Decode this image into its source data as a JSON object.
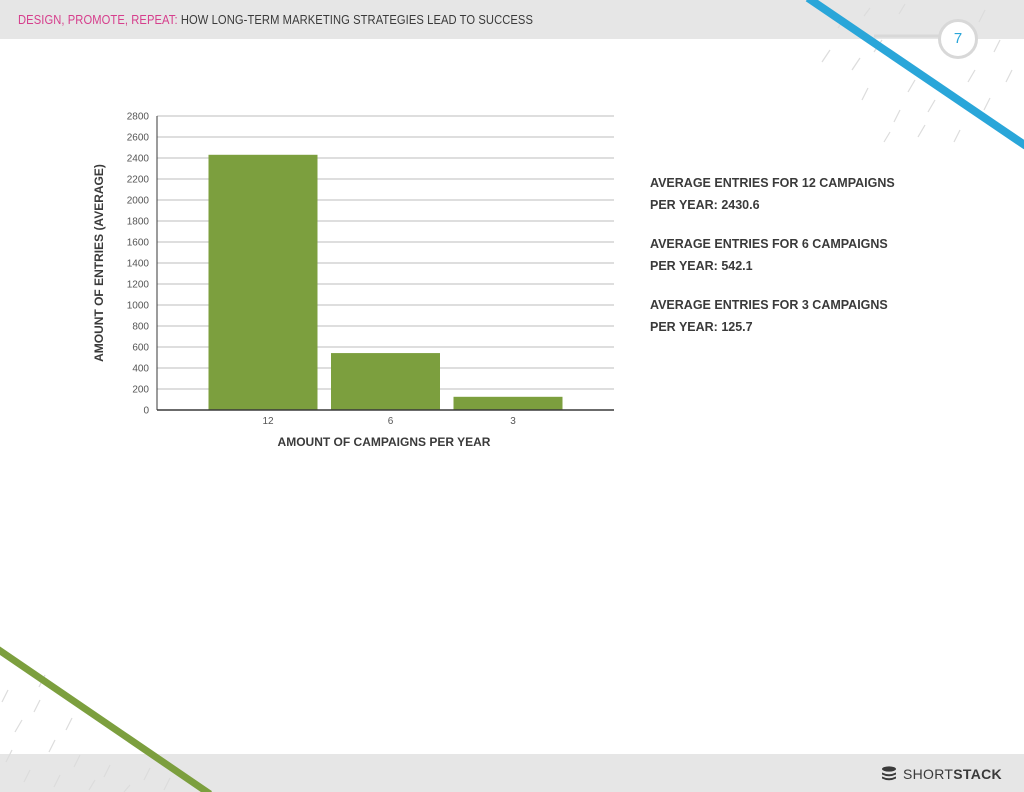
{
  "header": {
    "prefix": "DESIGN, PROMOTE, REPEAT:",
    "title": "HOW LONG-TERM MARKETING STRATEGIES LEAD TO SUCCESS"
  },
  "page_number": "7",
  "colors": {
    "accent_pink": "#d63e8c",
    "accent_blue": "#2aa6d9",
    "bar_green": "#7c9f3e",
    "stripe_green": "#7c9f3e",
    "bar_gray": "#e6e6e6"
  },
  "chart_data": {
    "type": "bar",
    "categories": [
      "12",
      "6",
      "3"
    ],
    "values": [
      2430.6,
      542.1,
      125.7
    ],
    "xlabel": "AMOUNT OF CAMPAIGNS PER YEAR",
    "ylabel": "AMOUNT OF ENTRIES (AVERAGE)",
    "ylim": [
      0,
      2800
    ],
    "yticks": [
      "0",
      "200",
      "400",
      "600",
      "800",
      "1000",
      "1200",
      "1400",
      "1600",
      "1800",
      "2000",
      "2200",
      "2400",
      "2600",
      "2800"
    ],
    "grid": true,
    "legend": "none"
  },
  "stats": [
    {
      "line1": "AVERAGE ENTRIES FOR 12 CAMPAIGNS",
      "line2": "PER YEAR: 2430.6"
    },
    {
      "line1": "AVERAGE ENTRIES FOR 6 CAMPAIGNS",
      "line2": "PER YEAR: 542.1"
    },
    {
      "line1": "AVERAGE ENTRIES FOR 3 CAMPAIGNS",
      "line2": "PER YEAR: 125.7"
    }
  ],
  "brand": {
    "short": "SHORT",
    "stack": "STACK",
    "icon": "stack-coins-icon"
  }
}
